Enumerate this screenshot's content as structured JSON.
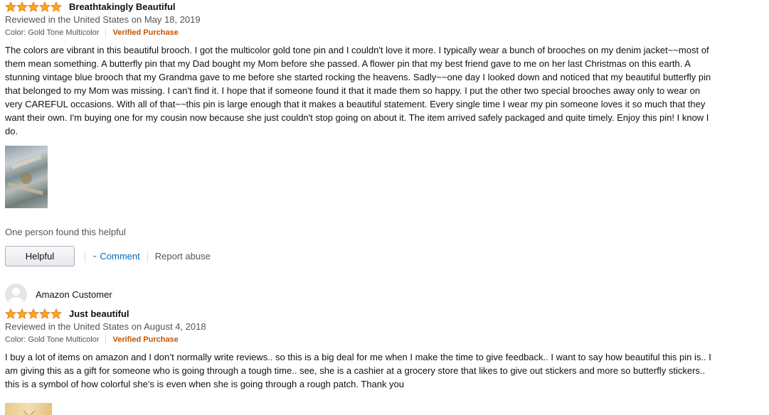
{
  "colors": {
    "star_fill": "#ffa41c",
    "star_stroke": "#de7921",
    "verified": "#c45500",
    "link": "#0066c0"
  },
  "reviews": [
    {
      "stars": 5,
      "title": "Breathtakingly Beautiful",
      "reviewed_on": "Reviewed in the United States on May 18, 2019",
      "color_label": "Color: Gold Tone Multicolor",
      "verified": "Verified Purchase",
      "body": "The colors are vibrant in this beautiful brooch. I got the multicolor gold tone pin and I couldn't love it more. I typically wear a bunch of brooches on my denim jacket~~most of them mean something. A butterfly pin that my Dad bought my Mom before she passed. A flower pin that my best friend gave to me on her last Christmas on this earth. A stunning vintage blue brooch that my Grandma gave to me before she started rocking the heavens. Sadly~~one day I looked down and noticed that my beautiful butterfly pin that belonged to my Mom was missing. I can't find it. I hope that if someone found it that it made them so happy. I put the other two special brooches away only to wear on very CAREFUL occasions. With all of that~~this pin is large enough that it makes a beautiful statement. Every single time I wear my pin someone loves it so much that they want their own. I'm buying one for my cousin now because she just couldn't stop going on about it. The item arrived safely packaged and quite timely. Enjoy this pin! I know I do.",
      "image_icon": "review-photo-thumbnail",
      "helpful_count": "One person found this helpful",
      "helpful_button": "Helpful",
      "comment_link": "Comment",
      "report_link": "Report abuse"
    },
    {
      "reviewer": "Amazon Customer",
      "stars": 5,
      "title": "Just beautiful",
      "reviewed_on": "Reviewed in the United States on August 4, 2018",
      "color_label": "Color: Gold Tone Multicolor",
      "verified": "Verified Purchase",
      "body": "I buy a lot of items on amazon and I don’t normally write reviews.. so this is a big deal for me when I make the time to give feedback.. I want to say how beautiful this pin is.. I am giving this as a gift for someone who is going through a tough time.. see, she is a cashier at a grocery store that likes to give out stickers and more so butterfly stickers.. this is a symbol of how colorful she’s is even when she is going through a rough patch. Thank you",
      "image_icon": "review-photo-thumbnail"
    }
  ]
}
